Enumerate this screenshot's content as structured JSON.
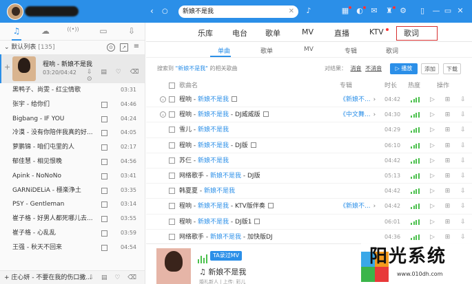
{
  "topbar": {
    "search_value": "新娘不是我",
    "search_clear": "✕",
    "back": "‹",
    "refresh": "○",
    "mic": "♪"
  },
  "sidebar": {
    "tabs": [
      "♫",
      "☁",
      "((•))",
      "▭",
      "⇩"
    ],
    "list_name": "默认列表",
    "list_count": "[135]",
    "now_playing": {
      "title": "程响 - 新娘不是我",
      "time": "03:20/04:42",
      "controls": "⇩ ▤ ♡ ⌫ ⊙"
    },
    "songs": [
      {
        "name": "黑鸭子、尚雯 - 红尘情歌",
        "dur": "03:31",
        "mv": false
      },
      {
        "name": "张宇 - 给你们",
        "dur": "04:46",
        "mv": true
      },
      {
        "name": "Bigbang - IF YOU",
        "dur": "04:24",
        "mv": true
      },
      {
        "name": "冷漠 - 没有你陪伴我真的好...",
        "dur": "04:05",
        "mv": true
      },
      {
        "name": "萝鹏锦 - 咱们屯里的人",
        "dur": "02:17",
        "mv": true
      },
      {
        "name": "郁佳慧 - 相见恨晚",
        "dur": "04:56",
        "mv": true
      },
      {
        "name": "Apink - NoNoNo",
        "dur": "03:41",
        "mv": true
      },
      {
        "name": "GARNiDELiA - 極楽浄土",
        "dur": "03:35",
        "mv": true
      },
      {
        "name": "PSY - Gentleman",
        "dur": "03:14",
        "mv": true
      },
      {
        "name": "崔子格 - 好男人都死哪儿去...",
        "dur": "03:55",
        "mv": true
      },
      {
        "name": "崔子格 - 心乱乱",
        "dur": "03:59",
        "mv": true
      },
      {
        "name": "王强 - 秋天不回来",
        "dur": "04:54",
        "mv": true
      }
    ],
    "bottom_row": "庄心妍 - 不要在我的伤口撒...",
    "bottom_controls": "⇩ ▤ ♡ ⌫"
  },
  "main_nav": [
    "乐库",
    "电台",
    "歌单",
    "MV",
    "直播",
    "KTV",
    "歌词"
  ],
  "sub_nav": [
    "单曲",
    "歌单",
    "MV",
    "专辑",
    "歌词"
  ],
  "result_bar": {
    "prefix": "搜索到",
    "keyword": "\"新娘不是我\"",
    "suffix": "的相关歌曲",
    "filter_label": "对结果：",
    "filter_opt1": "消音",
    "filter_opt2": "不消音",
    "play_all": "▷ 播放",
    "add": "添加",
    "download": "下载"
  },
  "table_head": {
    "song": "歌曲名",
    "album": "专辑",
    "time": "时长",
    "heat": "热度",
    "ops": "操作"
  },
  "rows": [
    {
      "artist": "程响",
      "title": "新娘不是我",
      "extra": "",
      "mv": true,
      "album": "《新娘不...",
      "time": "04:42",
      "expand": true
    },
    {
      "artist": "程响",
      "title": "新娘不是我",
      "extra": " - DJ威威版",
      "mv": true,
      "album": "《中文舞...",
      "time": "04:30",
      "expand": true
    },
    {
      "artist": "雪儿",
      "title": "新娘不是我",
      "extra": "",
      "mv": false,
      "album": "",
      "time": "04:29",
      "expand": false
    },
    {
      "artist": "程响",
      "title": "新娘不是我",
      "extra": " - DJ版",
      "mv": true,
      "album": "",
      "time": "06:10",
      "expand": false
    },
    {
      "artist": "苏仨",
      "title": "新娘不是我",
      "extra": "",
      "mv": false,
      "album": "",
      "time": "04:42",
      "expand": false
    },
    {
      "artist": "网络歌手",
      "title": "新娘不是我",
      "extra": " - DJ版",
      "mv": false,
      "album": "",
      "time": "05:13",
      "expand": false
    },
    {
      "artist": "韩夏夏",
      "title": "新娘不是我",
      "extra": "",
      "mv": false,
      "album": "",
      "time": "04:42",
      "expand": false
    },
    {
      "artist": "程响",
      "title": "新娘不是我",
      "extra": " - KTV版伴奏",
      "mv": true,
      "album": "《新娘不...",
      "time": "04:42",
      "expand": false
    },
    {
      "artist": "程响",
      "title": "新娘不是我",
      "extra": " - DJ版1",
      "mv": true,
      "album": "",
      "time": "06:01",
      "expand": false
    },
    {
      "artist": "网络歌手",
      "title": "新娘不是我",
      "extra": " - 加快版DJ",
      "mv": false,
      "album": "",
      "time": "04:36",
      "expand": false
    }
  ],
  "row_ops": "▷ ⊞ ⇩",
  "promo": {
    "tag": "TA录过MV",
    "title": "♫ 新娘不是我",
    "sub": "婚礼新人 | 上传: 彩儿"
  },
  "watermark": {
    "text": "阳光系统",
    "url": "www.010dh.com"
  },
  "colors": {
    "accent": "#2b8fe8",
    "heat": "#49c04b",
    "highlight_box": "#d62d2d"
  }
}
